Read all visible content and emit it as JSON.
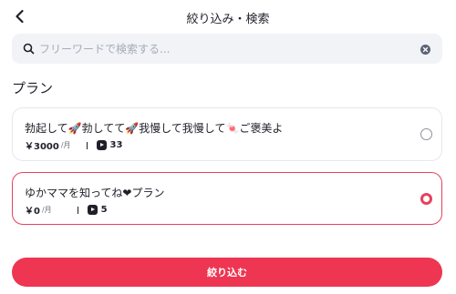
{
  "header": {
    "title": "絞り込み・検索",
    "back_icon": "chevron-left-icon"
  },
  "search": {
    "placeholder": "フリーワードで検索する...",
    "value": "",
    "search_icon": "search-icon",
    "clear_icon": "clear-icon"
  },
  "section": {
    "title": "プラン"
  },
  "plans": [
    {
      "name": "勃起して🚀勃してて🚀我慢して我慢して🍬ご褒美よ",
      "price": "￥3000",
      "unit": "/月",
      "count": "33",
      "selected": false
    },
    {
      "name": "ゆかママを知ってね❤プラン",
      "price": "￥0",
      "unit": "/月",
      "count": "5",
      "selected": true
    }
  ],
  "footer": {
    "submit_label": "絞り込む"
  },
  "colors": {
    "accent": "#ee3552",
    "selected_border": "#e8405e",
    "search_bg": "#f1f3f6"
  }
}
